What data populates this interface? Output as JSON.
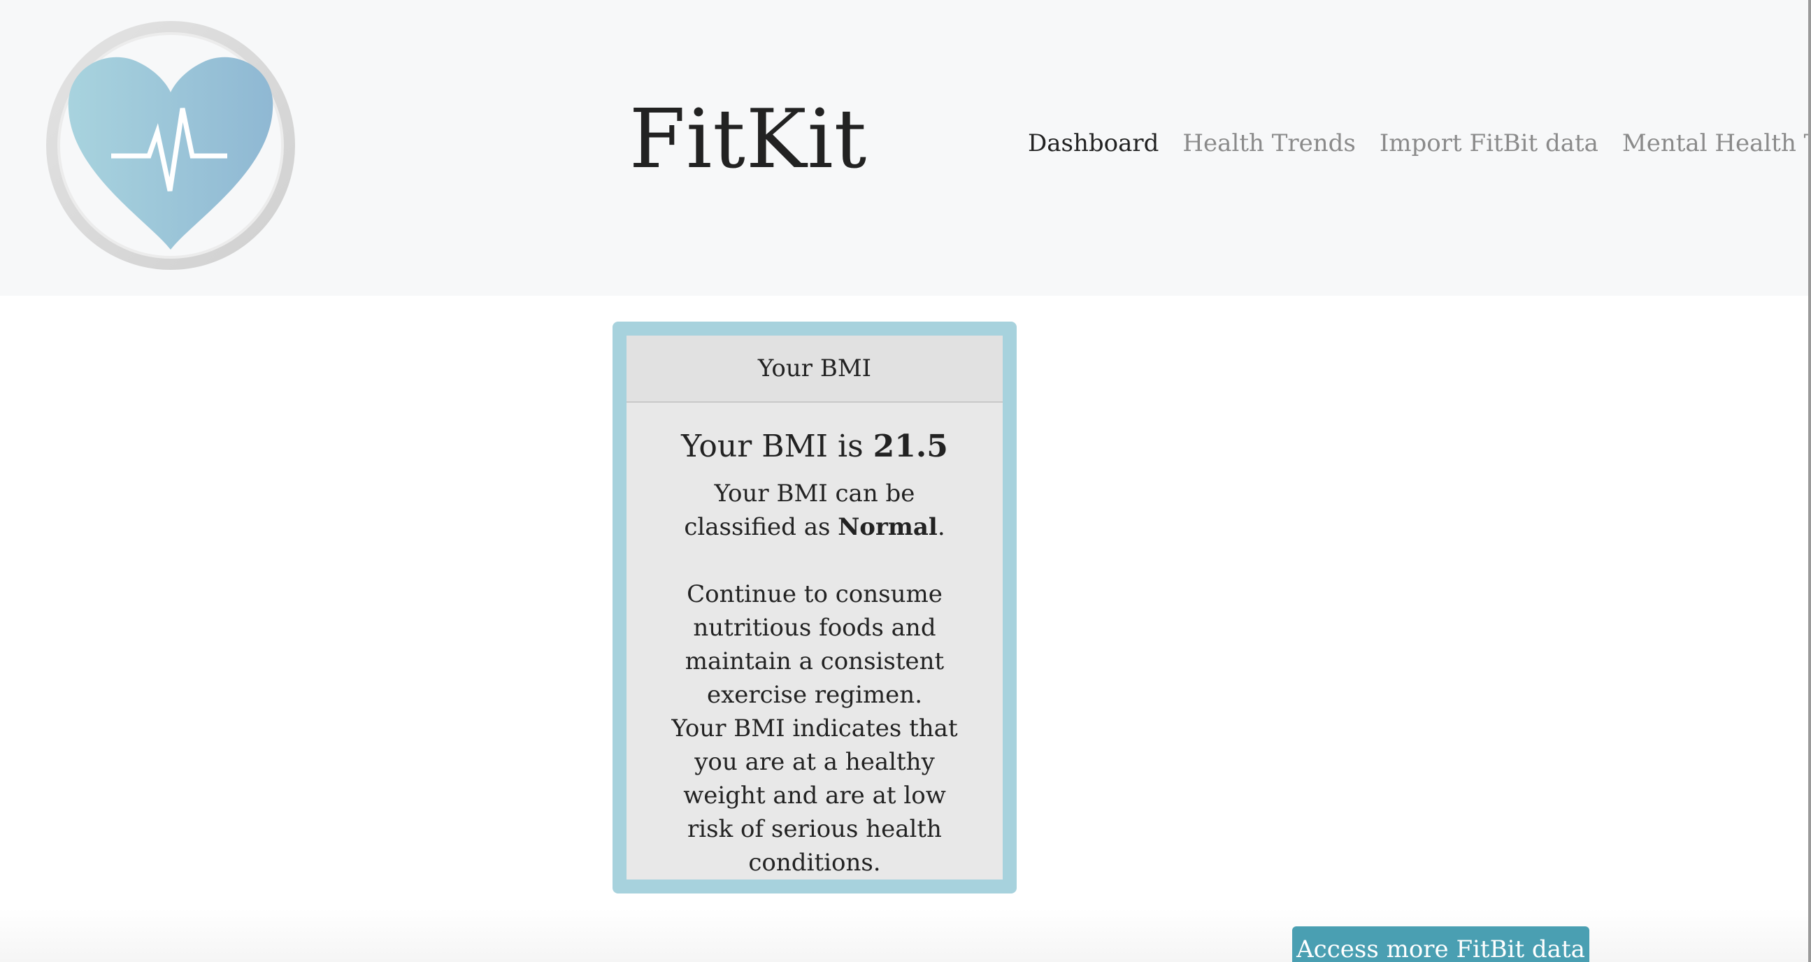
{
  "app": {
    "name": "FitKit"
  },
  "nav": {
    "items": [
      {
        "label": "Dashboard",
        "active": true
      },
      {
        "label": "Health Trends",
        "active": false
      },
      {
        "label": "Import FitBit data",
        "active": false
      },
      {
        "label": "Mental Health Tests",
        "active": false
      }
    ]
  },
  "logo": {
    "icon": "heart-pulse-icon",
    "colors": {
      "ring": "#d6d6d6",
      "heart_start": "#a8d3de",
      "heart_end": "#8fb8d3"
    }
  },
  "bmi_card": {
    "title": "Your BMI",
    "bmi_prefix": "Your BMI is ",
    "bmi_value": "21.5",
    "classification_prefix": "Your BMI can be classified as ",
    "classification": "Normal",
    "classification_suffix": ".",
    "advice": "Continue to consume nutritious foods and maintain a consistent exercise regimen.",
    "interpretation": "Your BMI indicates that you are at a healthy weight and are at low risk of serious health conditions."
  },
  "actions": {
    "more_fitbit_label": "Access more FitBit data"
  },
  "colors": {
    "card_border": "#a7d2dd",
    "button": "#4a9fb2",
    "header_bg": "#f7f8f9"
  }
}
